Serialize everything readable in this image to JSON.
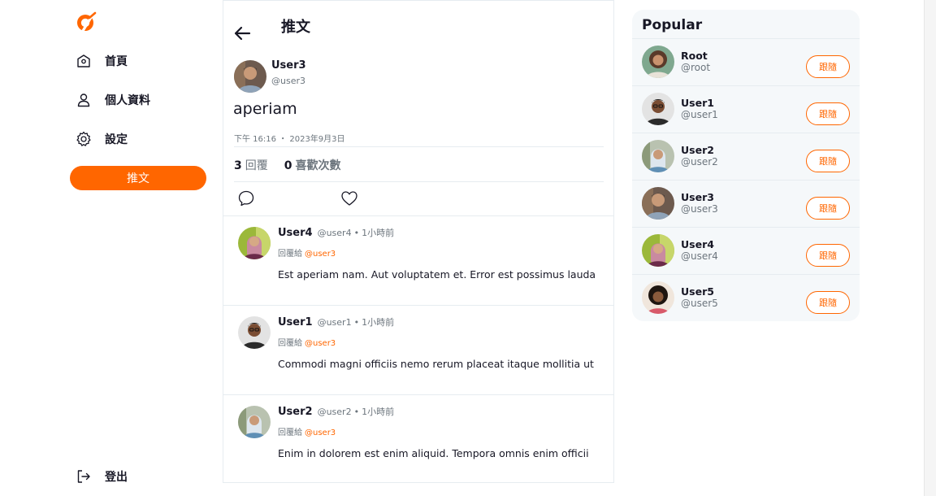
{
  "nav": {
    "items": [
      {
        "label": "首頁"
      },
      {
        "label": "個人資料"
      },
      {
        "label": "設定"
      }
    ],
    "tweet_button": "推文",
    "logout": "登出"
  },
  "header": {
    "title": "推文"
  },
  "tweet": {
    "name": "User3",
    "handle": "@user3",
    "text": "aperiam",
    "time": "下午 16:16 ・ 2023年9月3日",
    "reply_count": "3",
    "reply_label": "回覆",
    "like_count": "0",
    "like_label": "喜歡次數"
  },
  "replies": [
    {
      "name": "User4",
      "handle": "@user4",
      "time": "1小時前",
      "reply_to_label": "回覆給",
      "reply_to": "@user3",
      "text": "Est aperiam nam. Aut voluptatem et. Error est possimus lauda"
    },
    {
      "name": "User1",
      "handle": "@user1",
      "time": "1小時前",
      "reply_to_label": "回覆給",
      "reply_to": "@user3",
      "text": "Commodi magni officiis nemo rerum placeat itaque mollitia ut"
    },
    {
      "name": "User2",
      "handle": "@user2",
      "time": "1小時前",
      "reply_to_label": "回覆給",
      "reply_to": "@user3",
      "text": "Enim in dolorem est enim aliquid. Tempora omnis enim officii"
    }
  ],
  "popular": {
    "title": "Popular",
    "users": [
      {
        "name": "Root",
        "handle": "@root",
        "follow": "跟隨"
      },
      {
        "name": "User1",
        "handle": "@user1",
        "follow": "跟隨"
      },
      {
        "name": "User2",
        "handle": "@user2",
        "follow": "跟隨"
      },
      {
        "name": "User3",
        "handle": "@user3",
        "follow": "跟隨"
      },
      {
        "name": "User4",
        "handle": "@user4",
        "follow": "跟隨"
      },
      {
        "name": "User5",
        "handle": "@user5",
        "follow": "跟隨"
      }
    ]
  },
  "colors": {
    "accent": "#ff6600",
    "muted": "#6c757d",
    "text": "#171725"
  }
}
